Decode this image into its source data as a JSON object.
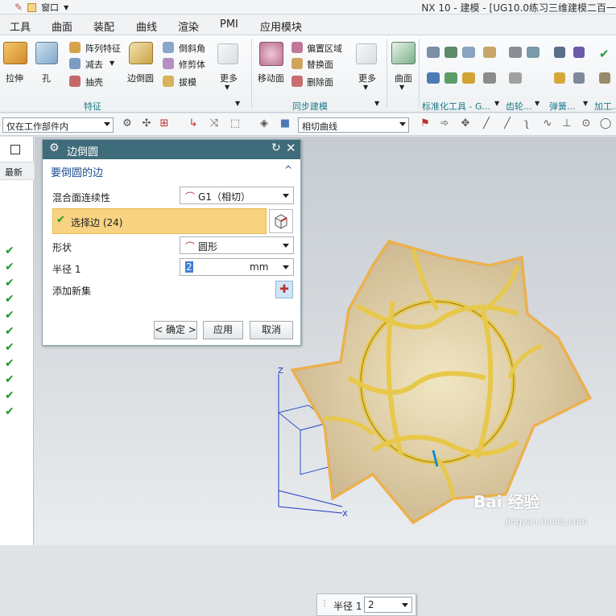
{
  "window": {
    "title": "NX 10 - 建模 - [UG10.0练习三维建模二百一",
    "quick_menu": "窗口"
  },
  "menu": {
    "tabs": [
      "工具",
      "曲面",
      "装配",
      "曲线",
      "渲染",
      "PMI",
      "应用模块"
    ]
  },
  "ribbon": {
    "feature": {
      "extrude": "拉伸",
      "hole": "孔",
      "pattern": "阵列特征",
      "subtract": "减去",
      "shell": "抽壳",
      "edge_blend": "边倒圆",
      "chamfer": "倒斜角",
      "trim_body": "修剪体",
      "draft": "拔模",
      "more": "更多",
      "group": "特征"
    },
    "sync": {
      "move_face": "移动面",
      "offset_region": "偏置区域",
      "replace_face": "替换面",
      "delete_face": "删除面",
      "more": "更多",
      "group": "同步建模"
    },
    "surface": {
      "label": "曲面"
    },
    "groups": {
      "standard": "标准化工具 - G...",
      "gear": "齿轮...",
      "spring": "弹簧...",
      "machining": "加工..."
    }
  },
  "toolbar": {
    "filter": "仅在工作部件内",
    "curve_rule": "相切曲线"
  },
  "part_nav": {
    "column": "最新",
    "check_count": 11
  },
  "dialog": {
    "title": "边倒圆",
    "section": "要倒圆的边",
    "continuity_label": "混合面连续性",
    "continuity_value": "G1（相切）",
    "select_edge": "选择边 (24)",
    "shape_label": "形状",
    "shape_value": "圆形",
    "radius_label": "半径 1",
    "radius_value": "2",
    "radius_unit": "mm",
    "add_set": "添加新集",
    "ok": "< 确定 >",
    "apply": "应用",
    "cancel": "取消"
  },
  "viewport": {
    "onscreen_label": "半径 1",
    "onscreen_value": "2",
    "axis_z": "Z",
    "axis_x": "X",
    "watermark": "Bai 经验",
    "watermark_url": "jingyan.baidu.com"
  },
  "colors": {
    "dialog_title": "#3f6c7a",
    "accent": "#1f7a89",
    "selection": "#f8d381",
    "highlight_edge": "#f0a040",
    "blend": "#e8c84a"
  }
}
